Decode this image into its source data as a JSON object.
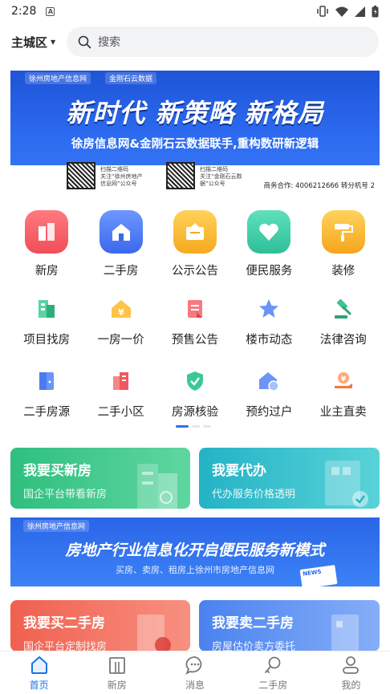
{
  "status": {
    "time": "2:28",
    "a_badge": "A"
  },
  "header": {
    "city": "主城区",
    "search_placeholder": "搜索"
  },
  "banner": {
    "brand_left": "徐州房地产信息网",
    "brand_right": "金刚石云数据",
    "headline": "新时代 新策略 新格局",
    "subline": "徐房信息网&金刚石云数据联手,重构数研新逻辑",
    "qr1_text": "扫描二维码\n关注“徐州房地产\n信息网”公众号",
    "qr2_text": "扫描二维码\n关注“金刚石云数\n据”公众号",
    "contact": "商务合作: 4006212666 转分机号 2"
  },
  "grid": {
    "row1": [
      {
        "label": "新房",
        "icon": "new-house-icon",
        "color": "#f45b62"
      },
      {
        "label": "二手房",
        "icon": "second-hand-house-icon",
        "color": "#4a78f0"
      },
      {
        "label": "公示公告",
        "icon": "notice-board-icon",
        "color": "#f6b632"
      },
      {
        "label": "便民服务",
        "icon": "heart-icon",
        "color": "#3ec9a4"
      },
      {
        "label": "装修",
        "icon": "paint-roller-icon",
        "color": "#f7b22d"
      }
    ],
    "row2": [
      {
        "label": "项目找房",
        "icon": "project-building-icon",
        "color": "#3fbf8a"
      },
      {
        "label": "一房一价",
        "icon": "price-tag-house-icon",
        "color": "#f5a623"
      },
      {
        "label": "预售公告",
        "icon": "presale-document-icon",
        "color": "#f0575c"
      },
      {
        "label": "楼市动态",
        "icon": "star-trend-icon",
        "color": "#5b86f2"
      },
      {
        "label": "法律咨询",
        "icon": "gavel-icon",
        "color": "#2fbf84"
      }
    ],
    "row3": [
      {
        "label": "二手房源",
        "icon": "door-icon",
        "color": "#4f7ff0"
      },
      {
        "label": "二手小区",
        "icon": "community-building-icon",
        "color": "#f0575c"
      },
      {
        "label": "房源核验",
        "icon": "shield-check-icon",
        "color": "#34c48e"
      },
      {
        "label": "预约过户",
        "icon": "transfer-house-icon",
        "color": "#5b86f2"
      },
      {
        "label": "业主直卖",
        "icon": "owner-sale-icon",
        "color": "#f57a3a"
      }
    ]
  },
  "cards": {
    "buy_new": {
      "title": "我要买新房",
      "subtitle": "国企平台带看新房",
      "color": "#2fbf7f"
    },
    "agent": {
      "title": "我要代办",
      "subtitle": "代办服务价格透明",
      "color": "#27b8c8"
    },
    "buy_second": {
      "title": "我要买二手房",
      "subtitle": "国企平台定制找房",
      "color": "#f06b5a"
    },
    "sell_second": {
      "title": "我要卖二手房",
      "subtitle": "房屋估价卖方委托",
      "color": "#5a8df2"
    }
  },
  "ad2": {
    "brand": "徐州房地产信息网",
    "headline": "房地产行业信息化开启便民服务新模式",
    "subline": "买房、卖房、租房上徐州市房地产信息网",
    "tag": "NEWS"
  },
  "tabbar": [
    {
      "label": "首页",
      "icon": "home-icon",
      "active": true
    },
    {
      "label": "新房",
      "icon": "building-icon",
      "active": false
    },
    {
      "label": "消息",
      "icon": "chat-bubble-icon",
      "active": false
    },
    {
      "label": "二手房",
      "icon": "key-icon",
      "active": false
    },
    {
      "label": "我的",
      "icon": "user-icon",
      "active": false
    }
  ],
  "colors": {
    "accent": "#1a73e8",
    "search_bg": "#f2f3f5"
  }
}
